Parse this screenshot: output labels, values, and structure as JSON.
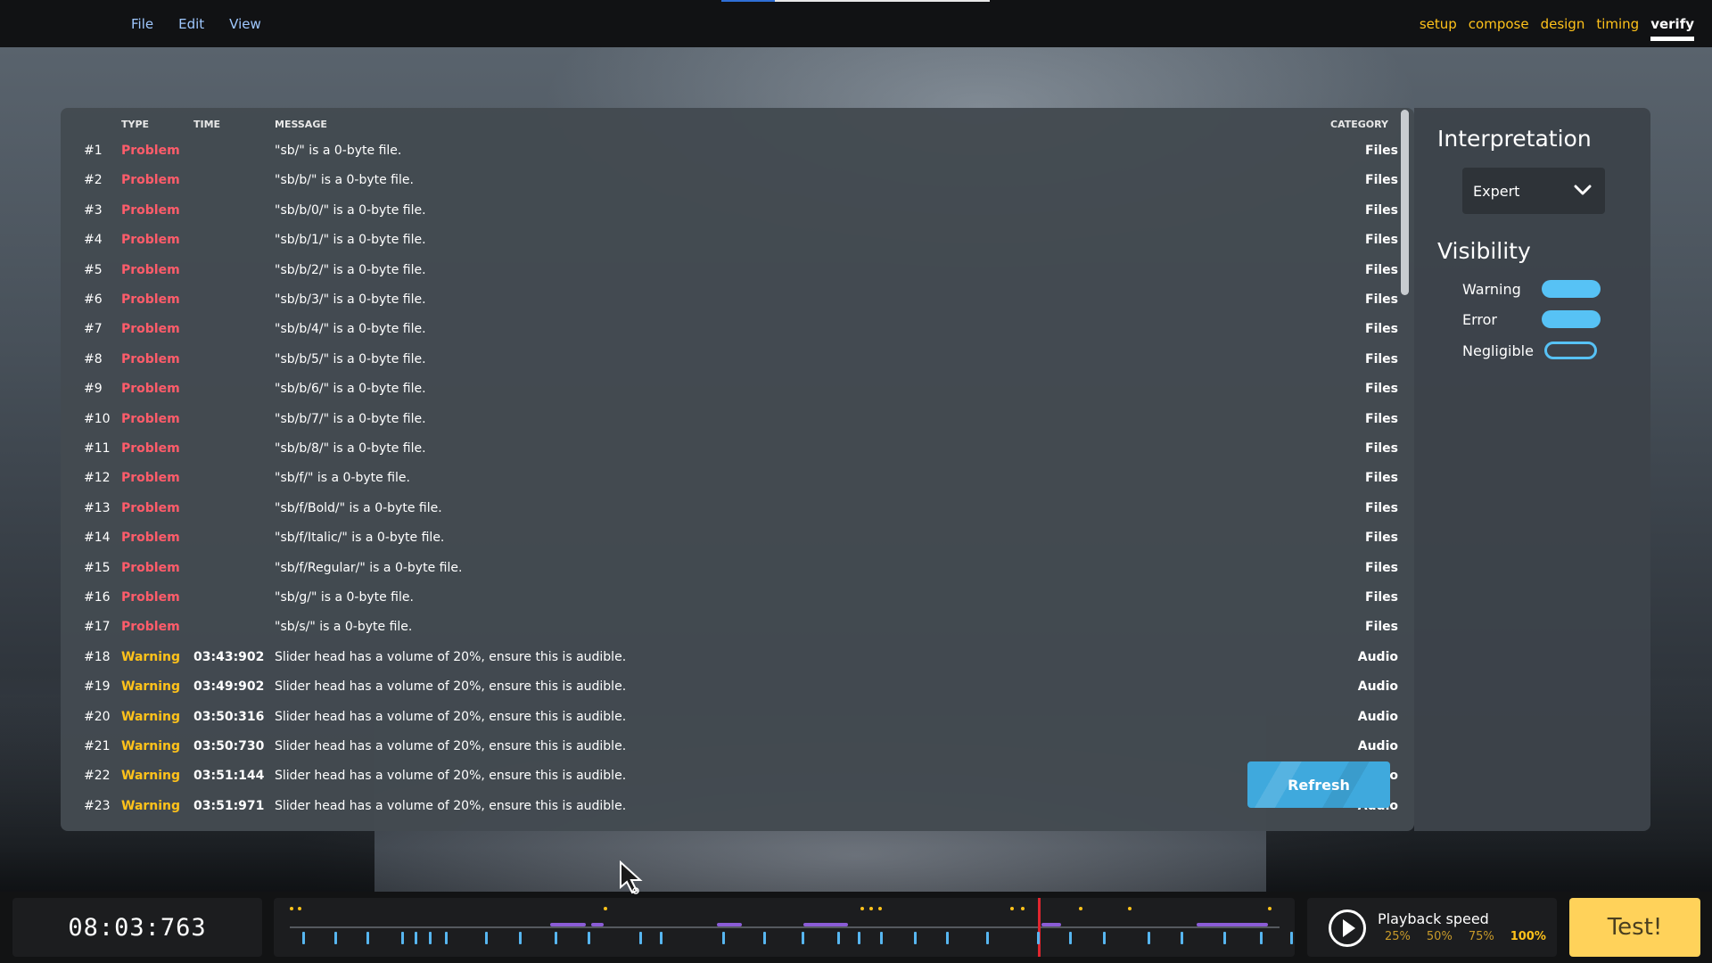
{
  "menu": [
    "File",
    "Edit",
    "View"
  ],
  "tabs": [
    {
      "label": "setup",
      "active": false
    },
    {
      "label": "compose",
      "active": false
    },
    {
      "label": "design",
      "active": false
    },
    {
      "label": "timing",
      "active": false
    },
    {
      "label": "verify",
      "active": true
    }
  ],
  "table": {
    "headers": {
      "type": "TYPE",
      "time": "TIME",
      "message": "MESSAGE",
      "category": "CATEGORY"
    },
    "rows": [
      {
        "num": "#1",
        "type": "Problem",
        "time": "",
        "message": "\"sb/\" is a 0-byte file.",
        "category": "Files"
      },
      {
        "num": "#2",
        "type": "Problem",
        "time": "",
        "message": "\"sb/b/\" is a 0-byte file.",
        "category": "Files"
      },
      {
        "num": "#3",
        "type": "Problem",
        "time": "",
        "message": "\"sb/b/0/\" is a 0-byte file.",
        "category": "Files"
      },
      {
        "num": "#4",
        "type": "Problem",
        "time": "",
        "message": "\"sb/b/1/\" is a 0-byte file.",
        "category": "Files"
      },
      {
        "num": "#5",
        "type": "Problem",
        "time": "",
        "message": "\"sb/b/2/\" is a 0-byte file.",
        "category": "Files"
      },
      {
        "num": "#6",
        "type": "Problem",
        "time": "",
        "message": "\"sb/b/3/\" is a 0-byte file.",
        "category": "Files"
      },
      {
        "num": "#7",
        "type": "Problem",
        "time": "",
        "message": "\"sb/b/4/\" is a 0-byte file.",
        "category": "Files"
      },
      {
        "num": "#8",
        "type": "Problem",
        "time": "",
        "message": "\"sb/b/5/\" is a 0-byte file.",
        "category": "Files"
      },
      {
        "num": "#9",
        "type": "Problem",
        "time": "",
        "message": "\"sb/b/6/\" is a 0-byte file.",
        "category": "Files"
      },
      {
        "num": "#10",
        "type": "Problem",
        "time": "",
        "message": "\"sb/b/7/\" is a 0-byte file.",
        "category": "Files"
      },
      {
        "num": "#11",
        "type": "Problem",
        "time": "",
        "message": "\"sb/b/8/\" is a 0-byte file.",
        "category": "Files"
      },
      {
        "num": "#12",
        "type": "Problem",
        "time": "",
        "message": "\"sb/f/\" is a 0-byte file.",
        "category": "Files"
      },
      {
        "num": "#13",
        "type": "Problem",
        "time": "",
        "message": "\"sb/f/Bold/\" is a 0-byte file.",
        "category": "Files"
      },
      {
        "num": "#14",
        "type": "Problem",
        "time": "",
        "message": "\"sb/f/Italic/\" is a 0-byte file.",
        "category": "Files"
      },
      {
        "num": "#15",
        "type": "Problem",
        "time": "",
        "message": "\"sb/f/Regular/\" is a 0-byte file.",
        "category": "Files"
      },
      {
        "num": "#16",
        "type": "Problem",
        "time": "",
        "message": "\"sb/g/\" is a 0-byte file.",
        "category": "Files"
      },
      {
        "num": "#17",
        "type": "Problem",
        "time": "",
        "message": "\"sb/s/\" is a 0-byte file.",
        "category": "Files"
      },
      {
        "num": "#18",
        "type": "Warning",
        "time": "03:43:902",
        "message": "Slider head has a volume of 20%, ensure this is audible.",
        "category": "Audio"
      },
      {
        "num": "#19",
        "type": "Warning",
        "time": "03:49:902",
        "message": "Slider head has a volume of 20%, ensure this is audible.",
        "category": "Audio"
      },
      {
        "num": "#20",
        "type": "Warning",
        "time": "03:50:316",
        "message": "Slider head has a volume of 20%, ensure this is audible.",
        "category": "Audio"
      },
      {
        "num": "#21",
        "type": "Warning",
        "time": "03:50:730",
        "message": "Slider head has a volume of 20%, ensure this is audible.",
        "category": "Audio"
      },
      {
        "num": "#22",
        "type": "Warning",
        "time": "03:51:144",
        "message": "Slider head has a volume of 20%, ensure this is audible.",
        "category": "Audio"
      },
      {
        "num": "#23",
        "type": "Warning",
        "time": "03:51:971",
        "message": "Slider head has a volume of 20%, ensure this is audible.",
        "category": "Audio"
      }
    ]
  },
  "refresh_label": "Refresh",
  "interpretation": {
    "title": "Interpretation",
    "selected": "Expert"
  },
  "visibility": {
    "title": "Visibility",
    "items": [
      {
        "label": "Warning",
        "on": true
      },
      {
        "label": "Error",
        "on": true
      },
      {
        "label": "Negligible",
        "on": false
      }
    ]
  },
  "clock": "08:03:763",
  "playback": {
    "title": "Playback speed",
    "speeds": [
      {
        "label": "25%",
        "active": false
      },
      {
        "label": "50%",
        "active": false
      },
      {
        "label": "75%",
        "active": false
      },
      {
        "label": "100%",
        "active": true
      }
    ]
  },
  "test_label": "Test!",
  "colors": {
    "problem": "#ff5c6a",
    "warning": "#ffc21a",
    "accent": "#57c2f5",
    "tab": "#ffc21a",
    "timeline_cursor": "#e0262f",
    "test_button": "#ffd25a"
  }
}
